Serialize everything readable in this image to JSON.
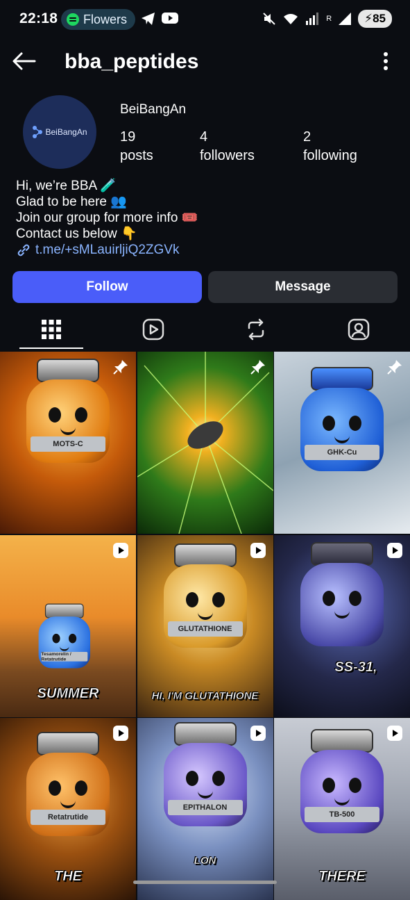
{
  "status_bar": {
    "time": "22:18",
    "media_label": "Flowers",
    "battery": "85",
    "signal_roaming": "R"
  },
  "header": {
    "username": "bba_peptides",
    "back_icon": "arrow-left-icon",
    "more_icon": "more-vertical-icon"
  },
  "profile": {
    "avatar_text": "BeiBangAn",
    "display_name": "BeiBangAn",
    "stats": [
      {
        "number": "19",
        "label": "posts"
      },
      {
        "number": "4",
        "label": "followers"
      },
      {
        "number": "2",
        "label": "following"
      }
    ],
    "bio": [
      "Hi, we’re BBA 🧪",
      "Glad to be here 👥",
      "Join our group for more info 🎟️",
      "Contact us below 👇"
    ],
    "link": "t.me/+sMLauirljiQ2ZGVk"
  },
  "actions": {
    "follow_label": "Follow",
    "message_label": "Message"
  },
  "tabs": [
    {
      "icon": "grid-icon",
      "active": true
    },
    {
      "icon": "reels-icon",
      "active": false
    },
    {
      "icon": "repost-icon",
      "active": false
    },
    {
      "icon": "tagged-icon",
      "active": false
    }
  ],
  "colors": {
    "background": "#0b0d12",
    "follow_button": "#4a5df9",
    "message_button": "#2a2d33",
    "link": "#8ab4ff"
  },
  "posts": [
    {
      "badge": "pin-icon",
      "label": "MOTS-C",
      "caption": ""
    },
    {
      "badge": "pin-icon",
      "label": "",
      "caption": ""
    },
    {
      "badge": "pin-icon",
      "label": "GHK-Cu",
      "caption": ""
    },
    {
      "badge": "reel-icon",
      "label": "Tesamorelin / Retatrutide",
      "caption": "SUMMER"
    },
    {
      "badge": "reel-icon",
      "label": "GLUTATHIONE",
      "caption": "HI, I'M GLUTATHIONE"
    },
    {
      "badge": "reel-icon",
      "label": "",
      "caption": "SS-31,"
    },
    {
      "badge": "reel-icon",
      "label": "Retatrutide",
      "caption": "THE"
    },
    {
      "badge": "reel-icon",
      "label": "EPITHALON",
      "caption": "LON"
    },
    {
      "badge": "reel-icon",
      "label": "TB-500",
      "caption": "THERE"
    }
  ]
}
